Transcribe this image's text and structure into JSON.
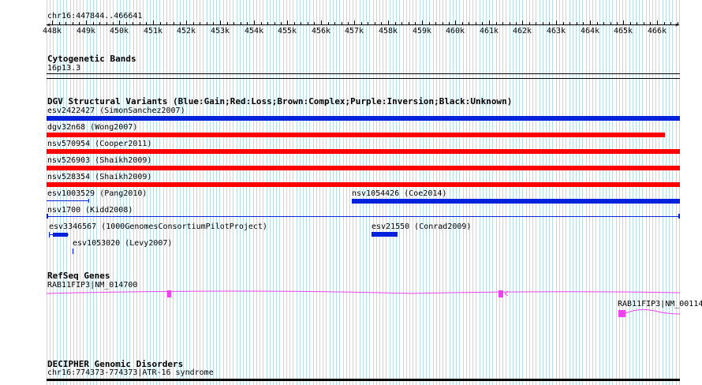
{
  "ruler": {
    "range_label": "chr16:447844..466641",
    "ticks": [
      "448k",
      "449k",
      "450k",
      "451k",
      "452k",
      "453k",
      "454k",
      "455k",
      "456k",
      "457k",
      "458k",
      "459k",
      "460k",
      "461k",
      "462k",
      "463k",
      "464k",
      "465k",
      "466k"
    ]
  },
  "cyto": {
    "title": "Cytogenetic Bands",
    "band": "16p13.3"
  },
  "dgv": {
    "title": "DGV Structural Variants (Blue:Gain;Red:Loss;Brown:Complex;Purple:Inversion;Black:Unknown)",
    "colors": {
      "gain": "#0022dd",
      "loss": "#ff0000"
    },
    "variants": [
      {
        "label": "esv2422427 (SimonSanchez2007)"
      },
      {
        "label": "dgv32n68 (Wong2007)"
      },
      {
        "label": "nsv570954 (Cooper2011)"
      },
      {
        "label": "nsv526903 (Shaikh2009)"
      },
      {
        "label": "nsv528354 (Shaikh2009)"
      },
      {
        "label": "esv1003529 (Pang2010)"
      },
      {
        "label": "nsv1054426 (Coe2014)"
      },
      {
        "label": "nsv1700 (Kidd2008)"
      },
      {
        "label": "esv3346567 (1000GenomesConsortiumPilotProject)"
      },
      {
        "label": "esv21550 (Conrad2009)"
      },
      {
        "label": "esv1053020 (Levy2007)"
      }
    ]
  },
  "refseq": {
    "title": "RefSeq Genes",
    "color": "#ee44ee",
    "genes": [
      {
        "label": "RAB11FIP3|NM_014700"
      },
      {
        "label": "RAB11FIP3|NM_00114"
      }
    ]
  },
  "decipher": {
    "title": "DECIPHER Genomic Disorders",
    "entry": "chr16:774373-774373|ATR-16 syndrome"
  }
}
